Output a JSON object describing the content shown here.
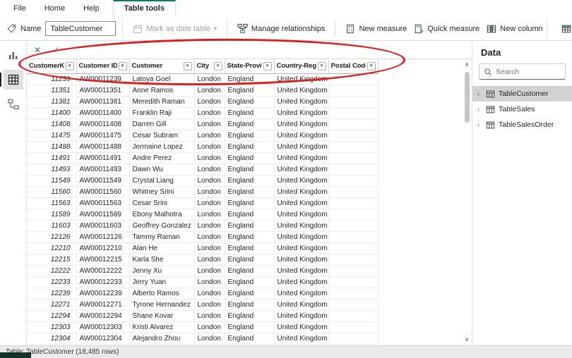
{
  "menu": {
    "items": [
      "File",
      "Home",
      "Help"
    ],
    "active_tab": "Table tools"
  },
  "ribbon": {
    "name_label": "Name",
    "name_value": "TableCustomer",
    "mark_as_date_table": "Mark as date table",
    "manage_relationships": "Manage relationships",
    "new_measure": "New measure",
    "quick_measure": "Quick measure",
    "new_column": "New column"
  },
  "icons": {
    "cancel": "✕",
    "commit": "✓",
    "dropdown": "▾",
    "expand": "›",
    "chevron_up": "∧",
    "chevron_down": "∨"
  },
  "table": {
    "columns": [
      "CustomerKey",
      "Customer ID",
      "Customer",
      "City",
      "State-Province",
      "Country-Region",
      "Postal Code"
    ],
    "rows": [
      [
        "11239",
        "AW00011239",
        "Latoya Goel",
        "London",
        "England",
        "United Kingdom",
        ""
      ],
      [
        "11351",
        "AW00011351",
        "Anne Ramos",
        "London",
        "England",
        "United Kingdom",
        ""
      ],
      [
        "11381",
        "AW00011381",
        "Meredith Raman",
        "London",
        "England",
        "United Kingdom",
        ""
      ],
      [
        "11400",
        "AW00011400",
        "Franklin Raji",
        "London",
        "England",
        "United Kingdom",
        ""
      ],
      [
        "11408",
        "AW00011408",
        "Darren Gill",
        "London",
        "England",
        "United Kingdom",
        ""
      ],
      [
        "11475",
        "AW00011475",
        "Cesar Subram",
        "London",
        "England",
        "United Kingdom",
        ""
      ],
      [
        "11488",
        "AW00011488",
        "Jermaine Lopez",
        "London",
        "England",
        "United Kingdom",
        ""
      ],
      [
        "11491",
        "AW00011491",
        "Andre Perez",
        "London",
        "England",
        "United Kingdom",
        ""
      ],
      [
        "11493",
        "AW00011493",
        "Dawn Wu",
        "London",
        "England",
        "United Kingdom",
        ""
      ],
      [
        "11549",
        "AW00011549",
        "Crystal Liang",
        "London",
        "England",
        "United Kingdom",
        ""
      ],
      [
        "11560",
        "AW00011560",
        "Whitney Srini",
        "London",
        "England",
        "United Kingdom",
        ""
      ],
      [
        "11563",
        "AW00011563",
        "Cesar Srini",
        "London",
        "England",
        "United Kingdom",
        ""
      ],
      [
        "11589",
        "AW00011589",
        "Ebony Malhotra",
        "London",
        "England",
        "United Kingdom",
        ""
      ],
      [
        "11603",
        "AW00011603",
        "Geoffrey Gonzalez",
        "London",
        "England",
        "United Kingdom",
        ""
      ],
      [
        "12126",
        "AW00012126",
        "Tammy Raman",
        "London",
        "England",
        "United Kingdom",
        ""
      ],
      [
        "12210",
        "AW00012210",
        "Alan He",
        "London",
        "England",
        "United Kingdom",
        ""
      ],
      [
        "12215",
        "AW00012215",
        "Karla She",
        "London",
        "England",
        "United Kingdom",
        ""
      ],
      [
        "12222",
        "AW00012222",
        "Jenny Xu",
        "London",
        "England",
        "United Kingdom",
        ""
      ],
      [
        "12233",
        "AW00012233",
        "Jerry Yuan",
        "London",
        "England",
        "United Kingdom",
        ""
      ],
      [
        "12239",
        "AW00012239",
        "Alberto Ramos",
        "London",
        "England",
        "United Kingdom",
        ""
      ],
      [
        "12271",
        "AW00012271",
        "Tyrone Hernandez",
        "London",
        "England",
        "United Kingdom",
        ""
      ],
      [
        "12294",
        "AW00012294",
        "Shane Kovar",
        "London",
        "England",
        "United Kingdom",
        ""
      ],
      [
        "12303",
        "AW00012303",
        "Kristi Alvarez",
        "London",
        "England",
        "United Kingdom",
        ""
      ],
      [
        "12304",
        "AW00012304",
        "Alejandro Zhou",
        "London",
        "England",
        "United Kingdom",
        ""
      ]
    ]
  },
  "fields_panel": {
    "title": "Data",
    "search_placeholder": "Search",
    "items": [
      {
        "label": "TableCustomer",
        "selected": true
      },
      {
        "label": "TableSales",
        "selected": false
      },
      {
        "label": "TableSalesOrder",
        "selected": false
      }
    ]
  },
  "status_bar": {
    "text": "Table: TableCustomer (18,485 rows)"
  },
  "colors": {
    "accent": "#117865",
    "annotation": "#d81e1e"
  }
}
